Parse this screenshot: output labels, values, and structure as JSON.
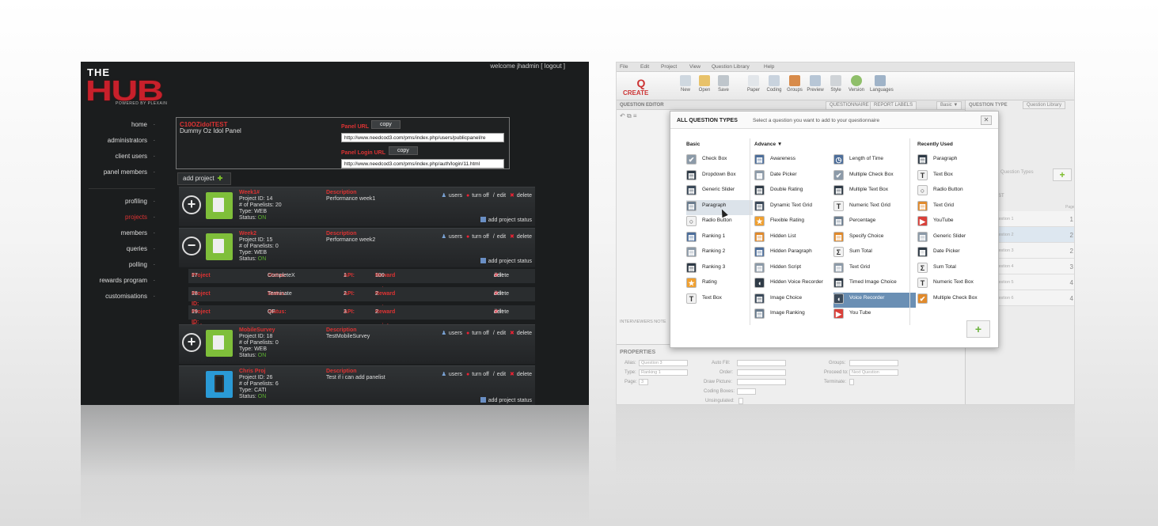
{
  "hub": {
    "welcome": "welcome jhadmin [ logout ]",
    "logo": {
      "the": "THE",
      "hub": "HUB",
      "powered": "POWERED BY PLEXAIN"
    },
    "nav_top": [
      "home",
      "administrators",
      "client users",
      "panel members"
    ],
    "nav_bottom": [
      "profiling",
      "projects",
      "members",
      "queries",
      "polling",
      "rewards program",
      "customisations"
    ],
    "active_nav": "projects",
    "panel": {
      "name": "C10OZidolTEST",
      "desc": "Dummy Oz Idol Panel",
      "url_label": "Panel URL",
      "url": "http://www.needcod3.com/pms/index.php/users/publicpanel/re",
      "login_label": "Panel Login URL",
      "login_url": "http://www.needcod3.com/pms/index.php/auth/login/11.html",
      "copy_label": "copy"
    },
    "add_project": "add project",
    "projects": [
      {
        "name": "Week1#",
        "id": "Project ID: 14",
        "panelists": "# of Panelists: 20",
        "type": "Type: WEB",
        "status_k": "Status:",
        "status_v": "ON",
        "desc_h": "Description",
        "desc": "Performance week1",
        "icon": "plus-circle"
      },
      {
        "name": "Week2",
        "id": "Project ID: 15",
        "panelists": "# of Panelists: 0",
        "type": "Type: WEB",
        "status_k": "Status:",
        "status_v": "ON",
        "desc_h": "Description",
        "desc": "Performance week2",
        "icon": "minus-circle"
      },
      {
        "name": "MobileSurvey",
        "id": "Project ID: 18",
        "panelists": "# of Panelists: 0",
        "type": "Type: WEB",
        "status_k": "Status:",
        "status_v": "ON",
        "desc_h": "Description",
        "desc": "TestMobileSurvey",
        "icon": "plus-circle"
      },
      {
        "name": "Chris Proj",
        "id": "Project ID: 26",
        "panelists": "# of Panelists: 6",
        "type": "Type: CATI",
        "status_k": "Status:",
        "status_v": "ON",
        "desc_h": "Description",
        "desc": "Test if i can add panelist",
        "icon": "none"
      }
    ],
    "actions": {
      "users": "users",
      "turnoff": "turn off",
      "edit": "edit",
      "delete": "delete",
      "add_status": "add project status"
    },
    "statuses": [
      {
        "id_k": "Project Status ID:",
        "id": "17",
        "st_k": "Status:",
        "st": "CompleteX",
        "api_k": "API:",
        "api": "1",
        "rp_k": "Reward points:",
        "rp": "100"
      },
      {
        "id_k": "Project Status ID:",
        "id": "18",
        "st_k": "Status:",
        "st": "Terminate",
        "api_k": "API:",
        "api": "2",
        "rp_k": "Reward points:",
        "rp": "2"
      },
      {
        "id_k": "Project Status ID:",
        "id": "19",
        "st_k": "Status:",
        "st": "QF",
        "api_k": "API:",
        "api": "3",
        "rp_k": "Reward points:",
        "rp": "2"
      }
    ]
  },
  "create": {
    "menu": [
      "File",
      "Edit",
      "Project",
      "View",
      "Question Library",
      "Help"
    ],
    "logo": "CREATE",
    "toolbar": [
      "New",
      "Open",
      "Save",
      "Paper",
      "Coding",
      "Groups",
      "Preview",
      "Style",
      "Version",
      "Languages"
    ],
    "subhdr": {
      "left": "QUESTION EDITOR",
      "tab1": "QUESTIONNAIRE",
      "tab2": "REPORT LABELS",
      "tab3": "Basic ▼",
      "qtype": "QUESTION TYPE",
      "qlib": "Question Library"
    },
    "interviewer_notes": "INTERVIEWERS NOTE",
    "properties": {
      "title": "PROPERTIES",
      "fields": [
        {
          "k": "Alias:",
          "v": "Question 3"
        },
        {
          "k": "Type:",
          "v": "Ranking 1"
        },
        {
          "k": "Page:",
          "v": "3"
        },
        {
          "k": "Auto Fill:",
          "v": ""
        },
        {
          "k": "Order:",
          "v": ""
        },
        {
          "k": "Draw Picture:",
          "v": ""
        },
        {
          "k": "Coding Boxes:",
          "v": ""
        },
        {
          "k": "Unsingulated:",
          "v": ""
        },
        {
          "k": "Groups:",
          "v": ""
        },
        {
          "k": "Proceed to:",
          "v": "Next Question"
        },
        {
          "k": "Terminate:",
          "v": ""
        }
      ]
    },
    "right": {
      "qtypes_label": "Question Types",
      "list_label": "LIST",
      "list": [
        {
          "t": "Question 1",
          "n": "1"
        },
        {
          "t": "Question 2",
          "n": "2"
        },
        {
          "t": "Question 3",
          "n": "2"
        },
        {
          "t": "Question 4",
          "n": "3"
        },
        {
          "t": "Question 5",
          "n": "4"
        },
        {
          "t": "Question 6",
          "n": "4"
        }
      ],
      "page_label": "Page"
    },
    "dialog": {
      "title": "ALL QUESTION TYPES",
      "subtitle": "Select a question you want to add to your questionnaire",
      "close": "✕",
      "col_basic": "Basic",
      "col_adv": "Advance ▼",
      "col_recent": "Recently Used",
      "basic": [
        "Check Box",
        "Dropdown Box",
        "Generic Slider",
        "Paragraph",
        "Radio Button",
        "Ranking 1",
        "Ranking 2",
        "Ranking 3",
        "Rating",
        "Text Box"
      ],
      "adv1": [
        "Awareness",
        "Date Picker",
        "Double Rating",
        "Dynamic Text Grid",
        "Flexible Rating",
        "Hidden List",
        "Hidden Paragraph",
        "Hidden Script",
        "Hidden Voice Recorder",
        "Image Choice",
        "Image Ranking"
      ],
      "adv2": [
        "Length of Time",
        "Multiple Check Box",
        "Multiple Text Box",
        "Numeric Text Grid",
        "Percentage",
        "Specify Choice",
        "Sum Total",
        "Text Grid",
        "Timed Image Choice",
        "Voice Recorder",
        "You Tube"
      ],
      "recent": [
        "Paragraph",
        "Text Box",
        "Radio Button",
        "Text Grid",
        "YouTube",
        "Generic Slider",
        "Date Picker",
        "Sum Total",
        "Numeric Text Box",
        "Multiple Check Box"
      ],
      "selected": "Voice Recorder",
      "hover": "Paragraph",
      "add": "+"
    }
  }
}
